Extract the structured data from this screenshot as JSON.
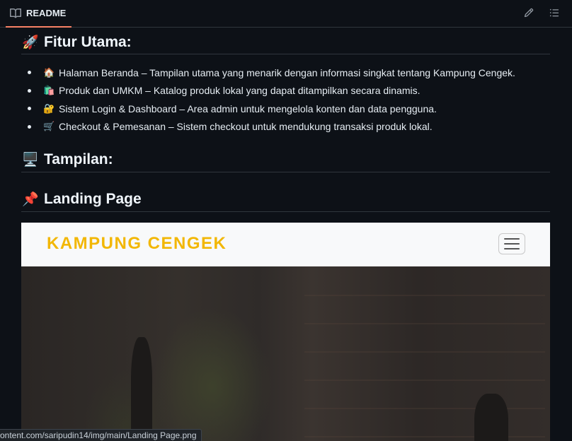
{
  "tabbar": {
    "tab_label": "README",
    "icons": {
      "tab": "book-icon",
      "edit": "pencil-icon",
      "outline": "list-unordered-icon"
    },
    "accent": "#f78166"
  },
  "sections": {
    "fitur": {
      "emoji": "🚀",
      "title": "Fitur Utama:"
    },
    "tampilan": {
      "emoji": "🖥️",
      "title": "Tampilan:"
    },
    "landing": {
      "emoji": "📌",
      "title": "Landing Page"
    }
  },
  "features": [
    {
      "emoji": "🏠",
      "text": "Halaman Beranda – Tampilan utama yang menarik dengan informasi singkat tentang Kampung Cengek."
    },
    {
      "emoji": "🛍️",
      "text": "Produk dan UMKM – Katalog produk lokal yang dapat ditampilkan secara dinamis."
    },
    {
      "emoji": "🔐",
      "text": "Sistem Login & Dashboard – Area admin untuk mengelola konten dan data pengguna."
    },
    {
      "emoji": "🛒",
      "text": "Checkout & Pemesanan – Sistem checkout untuk mendukung transaksi produk lokal."
    }
  ],
  "landing_image": {
    "brand": "KAMPUNG CENGEK",
    "brand_color": "#f2b705",
    "menu_icon": "hamburger-icon"
  },
  "status": {
    "url": "ontent.com/saripudin14/img/main/Landing Page.png"
  }
}
